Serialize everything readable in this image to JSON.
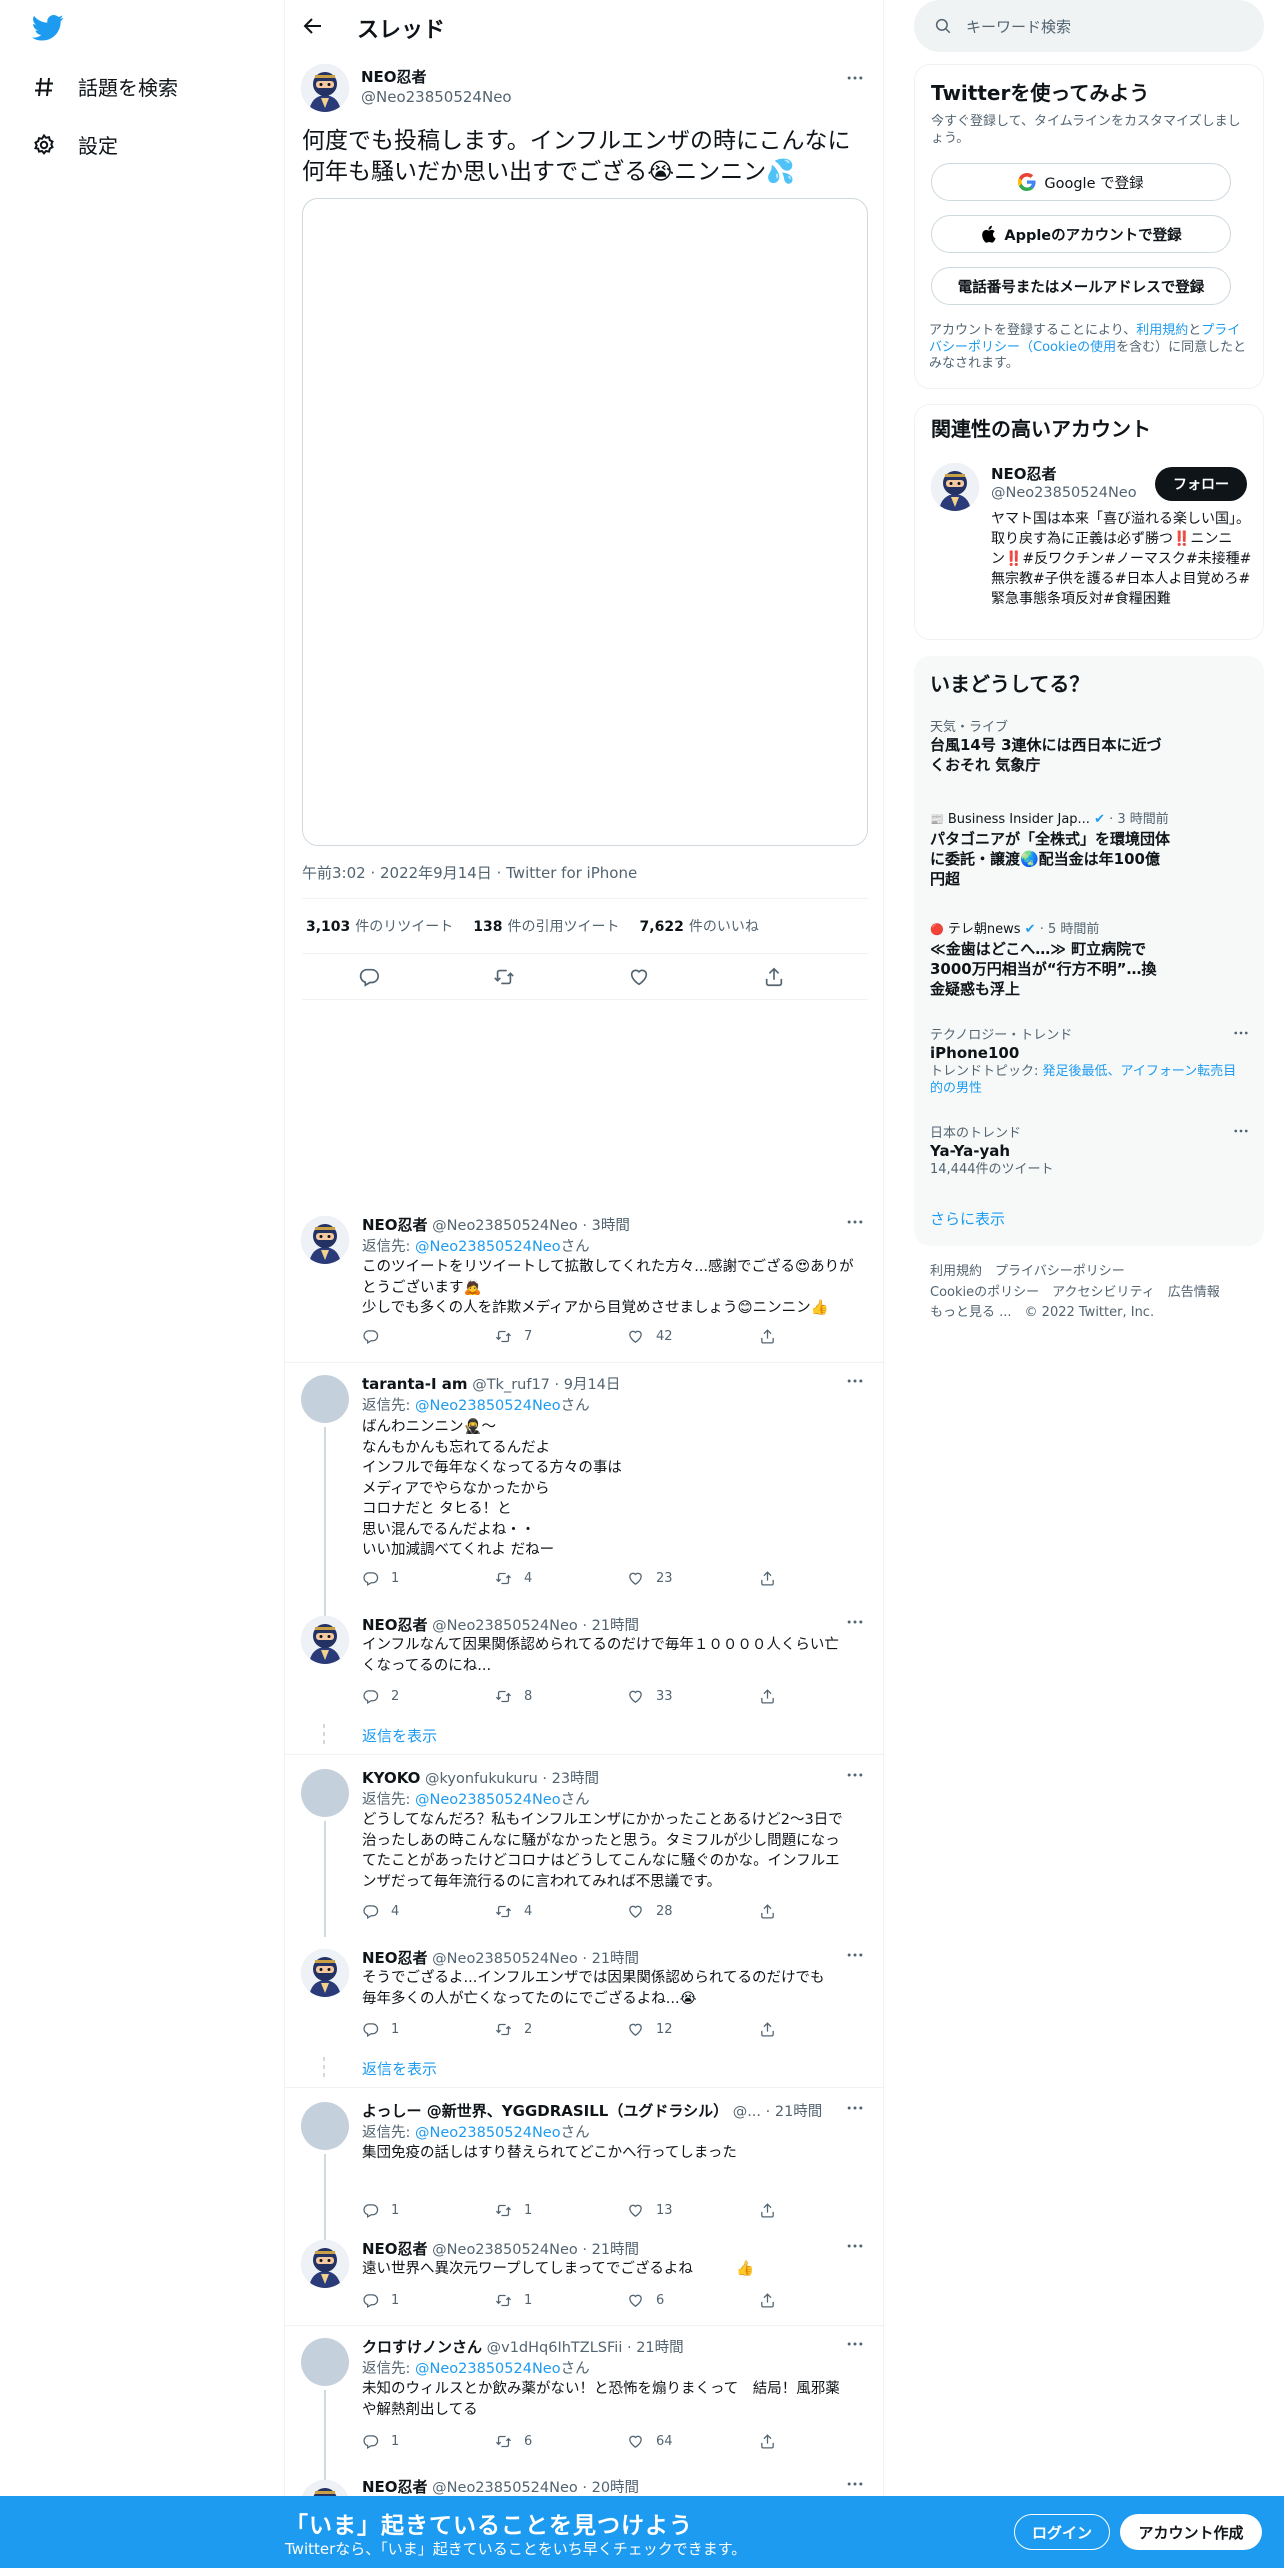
{
  "nav": {
    "logo": "twitter-logo",
    "explore_label": "話題を検索",
    "settings_label": "設定"
  },
  "header": {
    "title": "スレッド"
  },
  "main_tweet": {
    "name": "NEO忍者",
    "handle": "@Neo23850524Neo",
    "text": "何度でも投稿します。インフルエンザの時にこんなに何年も騒いだか思い出すでござる😭ニンニン💦",
    "time": "午前3:02",
    "date": "2022年9月14日",
    "source": "Twitter for iPhone",
    "retweets": "3,103",
    "retweets_label": "件のリツイート",
    "quotes": "138",
    "quotes_label": "件の引用ツイート",
    "likes": "7,622",
    "likes_label": "件のいいね"
  },
  "replies": [
    {
      "name": "NEO忍者",
      "handle": "@Neo23850524Neo",
      "time": "3時間",
      "reply_to_prefix": "返信先: ",
      "reply_to": "@Neo23850524Neo",
      "reply_to_suffix": "さん",
      "text_lines": [
        "このツイートをリツイートして拡散してくれた方々...感謝でござる😍ありがとうございます🙇",
        "少しでも多くの人を詐欺メディアから目覚めさせましょう😊ニンニン👍"
      ],
      "replies": "",
      "retweets": "7",
      "likes": "42"
    },
    {
      "name": "taranta-I am",
      "handle": "@Tk_ruf17",
      "time": "9月14日",
      "reply_to_prefix": "返信先: ",
      "reply_to": "@Neo23850524Neo",
      "reply_to_suffix": "さん",
      "text_lines": [
        "ばんわニンニン🥷～",
        "なんもかんも忘れてるんだよ",
        "インフルで毎年なくなってる方々の事は",
        "メディアでやらなかったから",
        "コロナだと タヒる！と",
        "思い混んでるんだよね・・",
        "いい加減調べてくれよ だねー"
      ],
      "replies": "1",
      "retweets": "4",
      "likes": "23"
    },
    {
      "name": "NEO忍者",
      "handle": "@Neo23850524Neo",
      "time": "21時間",
      "text_lines": [
        "インフルなんて因果関係認められてるのだけで毎年１００００人くらい亡",
        "くなってるのにね..."
      ],
      "replies": "2",
      "retweets": "8",
      "likes": "33"
    },
    {
      "name": "KYOKO",
      "handle": "@kyonfukukuru",
      "time": "23時間",
      "reply_to_prefix": "返信先: ",
      "reply_to": "@Neo23850524Neo",
      "reply_to_suffix": "さん",
      "text_lines": [
        "どうしてなんだろ？私もインフルエンザにかかったことあるけど2〜3日で",
        "治ったしあの時こんなに騒がなかったと思う。タミフルが少し問題になっ",
        "てたことがあったけどコロナはどうしてこんなに騒ぐのかな。インフルエ",
        "ンザだって毎年流行るのに言われてみれば不思議です。"
      ],
      "replies": "4",
      "retweets": "4",
      "likes": "28"
    },
    {
      "name": "NEO忍者",
      "handle": "@Neo23850524Neo",
      "time": "21時間",
      "text_lines": [
        "そうでござるよ...インフルエンザでは因果関係認められてるのだけでも",
        "毎年多くの人が亡くなってたのにでござるよね...😭"
      ],
      "replies": "1",
      "retweets": "2",
      "likes": "12"
    },
    {
      "name": "よっしー @新世界、YGGDRASILL（ユグドラシル）",
      "handle": "@...",
      "time": "21時間",
      "reply_to_prefix": "返信先: ",
      "reply_to": "@Neo23850524Neo",
      "reply_to_suffix": "さん",
      "text_lines": [
        "集団免疫の話しはすり替えられてどこかへ行ってしまった"
      ],
      "replies": "1",
      "retweets": "1",
      "likes": "13"
    },
    {
      "name": "NEO忍者",
      "handle": "@Neo23850524Neo",
      "time": "21時間",
      "text_lines": [
        "遠い世界へ異次元ワープしてしまってでござるよね　　　👍"
      ],
      "replies": "1",
      "retweets": "1",
      "likes": "6"
    },
    {
      "name": "クロすけノンさん",
      "handle": "@v1dHq6IhTZLSFii",
      "time": "21時間",
      "reply_to_prefix": "返信先: ",
      "reply_to": "@Neo23850524Neo",
      "reply_to_suffix": "さん",
      "text_lines": [
        "未知のウィルスとか飲み薬がない！と恐怖を煽りまくって　結局！風邪薬",
        "や解熱剤出してる"
      ],
      "replies": "1",
      "retweets": "6",
      "likes": "64"
    },
    {
      "name": "NEO忍者",
      "handle": "@Neo23850524Neo",
      "time": "20時間"
    }
  ],
  "show_replies_label": "返信を表示",
  "search": {
    "placeholder": "キーワード検索"
  },
  "signup_card": {
    "title": "Twitterを使ってみよう",
    "subtitle": "今すぐ登録して、タイムラインをカスタマイズしましょう。",
    "google_label": "Google で登録",
    "apple_label": "Appleのアカウントで登録",
    "phone_label": "電話番号またはメールアドレスで登録",
    "legal_prefix": "アカウントを登録することにより、",
    "legal_terms": "利用規約",
    "legal_and": "と",
    "legal_privacy": "プライバシーポリシー（Cookieの使用",
    "legal_suffix": "を含む）に同意したとみなされます。"
  },
  "related_card": {
    "title": "関連性の高いアカウント",
    "name": "NEO忍者",
    "handle": "@Neo23850524Neo",
    "follow_label": "フォロー",
    "bio": "ヤマト国は本来「喜び溢れる楽しい国」。取り戻す為に正義は必ず勝つ‼️ニンニン‼️#反ワクチン#ノーマスク#未接種#無宗教#子供を護る#日本人よ目覚めろ#緊急事態条項反対#食糧困難"
  },
  "trends_card": {
    "title": "いまどうしてる？",
    "items": [
      {
        "meta": "天気・ライブ",
        "title": "台風14号 3連休には西日本に近づくおそれ 気象庁",
        "sub": ""
      },
      {
        "meta": "Business Insider Jap...",
        "meta_time": "· 3 時間前",
        "title": "パタゴニアが「全株式」を環境団体に委託・譲渡🌏配当金は年100億円超",
        "sub": ""
      },
      {
        "meta": "テレ朝news",
        "meta_time": "· 5 時間前",
        "title": "≪金歯はどこへ…≫ 町立病院で3000万円相当が“行方不明”…換金疑惑も浮上",
        "sub": ""
      },
      {
        "meta": "テクノロジー・トレンド",
        "title": "iPhone100",
        "sub_prefix": "トレンドトピック: ",
        "sub_link": "発足後最低、アイフォーン転売目的の男性"
      },
      {
        "meta": "日本のトレンド",
        "title": "Ya-Ya-yah",
        "sub": "14,444件のツイート"
      }
    ],
    "show_more": "さらに表示"
  },
  "footer": {
    "links": [
      "利用規約",
      "プライバシーポリシー",
      "Cookieのポリシー",
      "アクセシビリティ",
      "広告情報",
      "もっと見る ...",
      "© 2022 Twitter, Inc."
    ]
  },
  "bottom_bar": {
    "title": "「いま」起きていることを見つけよう",
    "subtitle": "Twitterなら、「いま」起きていることをいち早くチェックできます。",
    "login_label": "ログイン",
    "signup_label": "アカウント作成"
  },
  "colors": {
    "accent": "#1d9bf0",
    "text": "#0f1419",
    "secondary": "#536471",
    "border": "#eff3f4"
  }
}
